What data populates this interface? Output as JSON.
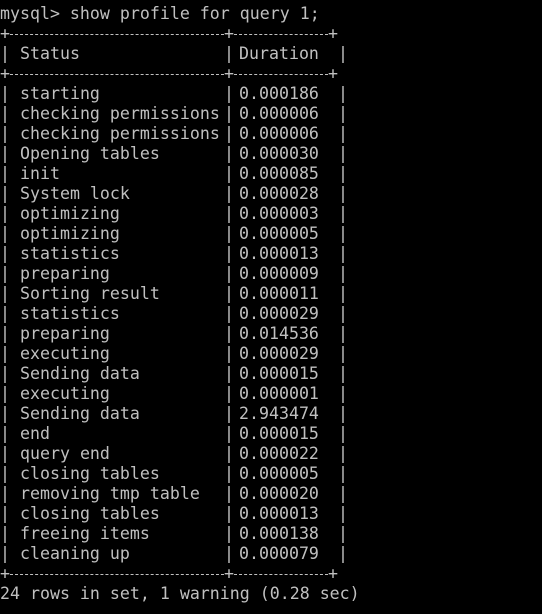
{
  "prompt": "mysql> show profile for query 1;",
  "table": {
    "headers": [
      "Status",
      "Duration"
    ],
    "rows": [
      [
        "starting",
        "0.000186"
      ],
      [
        "checking permissions",
        "0.000006"
      ],
      [
        "checking permissions",
        "0.000006"
      ],
      [
        "Opening tables",
        "0.000030"
      ],
      [
        "init",
        "0.000085"
      ],
      [
        "System lock",
        "0.000028"
      ],
      [
        "optimizing",
        "0.000003"
      ],
      [
        "optimizing",
        "0.000005"
      ],
      [
        "statistics",
        "0.000013"
      ],
      [
        "preparing",
        "0.000009"
      ],
      [
        "Sorting result",
        "0.000011"
      ],
      [
        "statistics",
        "0.000029"
      ],
      [
        "preparing",
        "0.014536"
      ],
      [
        "executing",
        "0.000029"
      ],
      [
        "Sending data",
        "0.000015"
      ],
      [
        "executing",
        "0.000001"
      ],
      [
        "Sending data",
        "2.943474"
      ],
      [
        "end",
        "0.000015"
      ],
      [
        "query end",
        "0.000022"
      ],
      [
        "closing tables",
        "0.000005"
      ],
      [
        "removing tmp table",
        "0.000020"
      ],
      [
        "closing tables",
        "0.000013"
      ],
      [
        "freeing items",
        "0.000138"
      ],
      [
        "cleaning up",
        "0.000079"
      ]
    ]
  },
  "footer": "24 rows in set, 1 warning (0.28 sec)",
  "colors": {
    "background": "#000000",
    "text": "#c0c0c0"
  }
}
